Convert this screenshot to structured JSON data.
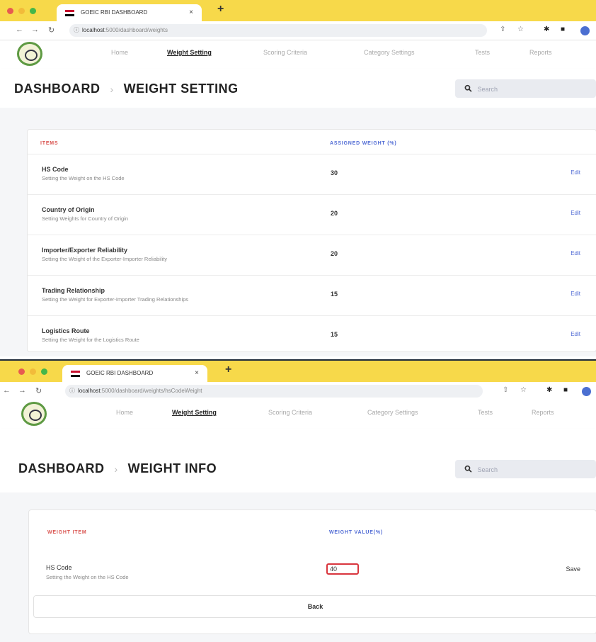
{
  "colors": {
    "tabbar": "#f7d94a",
    "accent_blue": "#4f6ad4",
    "accent_red": "#d9534f"
  },
  "screens": [
    {
      "browser": {
        "tab_title": "GOEIC RBI DASHBOARD",
        "close_glyph": "×",
        "newtab_glyph": "+",
        "url_host": "localhost",
        "url_path": ":5000/dashboard/weights"
      },
      "nav": {
        "home": "Home",
        "weight_setting": "Weight Setting",
        "scoring": "Scoring Criteria",
        "category": "Category Settings",
        "tests": "Tests",
        "reports": "Reports"
      },
      "breadcrumb": {
        "root": "DASHBOARD",
        "sep": "›",
        "current": "WEIGHT SETTING"
      },
      "search": {
        "placeholder": "Search"
      },
      "table": {
        "col_item": "ITEMS",
        "col_weight": "ASSIGNED WEIGHT (%)",
        "rows": [
          {
            "name": "HS Code",
            "desc": "Setting the Weight on the HS Code",
            "value": "30",
            "action": "Edit"
          },
          {
            "name": "Country of Origin",
            "desc": "Setting Weights for Country of Origin",
            "value": "20",
            "action": "Edit"
          },
          {
            "name": "Importer/Exporter Reliability",
            "desc": "Setting the Weight of the Exporter-Importer Reliability",
            "value": "20",
            "action": "Edit"
          },
          {
            "name": "Trading Relationship",
            "desc": "Setting the Weight for Exporter-Importer Trading Relationships",
            "value": "15",
            "action": "Edit"
          },
          {
            "name": "Logistics Route",
            "desc": "Setting the Weight for the Logistics Route",
            "value": "15",
            "action": "Edit"
          }
        ]
      }
    },
    {
      "browser": {
        "tab_title": "GOEIC RBI DASHBOARD",
        "close_glyph": "×",
        "newtab_glyph": "+",
        "url_host": "localhost",
        "url_path": ":5000/dashboard/weights/hsCodeWeight"
      },
      "nav": {
        "home": "Home",
        "weight_setting": "Weight Setting",
        "scoring": "Scoring Criteria",
        "category": "Category Settings",
        "tests": "Tests",
        "reports": "Reports"
      },
      "breadcrumb": {
        "root": "DASHBOARD",
        "sep": "›",
        "current": "WEIGHT INFO"
      },
      "search": {
        "placeholder": "Search"
      },
      "form": {
        "col_item": "WEIGHT ITEM",
        "col_value": "WEIGHT VALUE(%)",
        "item_name": "HS Code",
        "item_desc": "Setting the Weight on the HS Code",
        "input_value": "40",
        "save_label": "Save",
        "back_label": "Back"
      }
    }
  ]
}
